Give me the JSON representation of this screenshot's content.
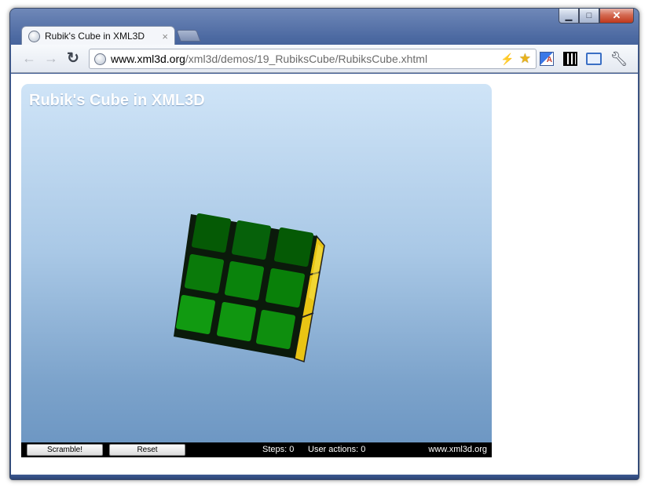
{
  "window": {
    "controls": {
      "minimize": "▁",
      "maximize": "□",
      "close": "✕"
    }
  },
  "tab": {
    "title": "Rubik's Cube in XML3D",
    "close": "×",
    "icon": "globe-icon"
  },
  "toolbar": {
    "back": "←",
    "forward": "→",
    "reload": "C",
    "url_host": "www.xml3d.org",
    "url_path": "/xml3d/demos/19_RubiksCube/RubiksCube.xhtml",
    "bolt": "⚡",
    "star": "★",
    "wrench": "🔧",
    "translate_letter": "A"
  },
  "demo": {
    "title": "Rubik's Cube in XML3D",
    "colors": {
      "face": "#0e7a0e",
      "side": "#f2d21c",
      "background_top": "#cfe4f7",
      "background_bottom": "#6a94c1"
    }
  },
  "controls": {
    "scramble_label": "Scramble!",
    "reset_label": "Reset",
    "steps_text": "Steps: 0",
    "user_actions_text": "User actions: 0",
    "site_text": "www.xml3d.org"
  }
}
